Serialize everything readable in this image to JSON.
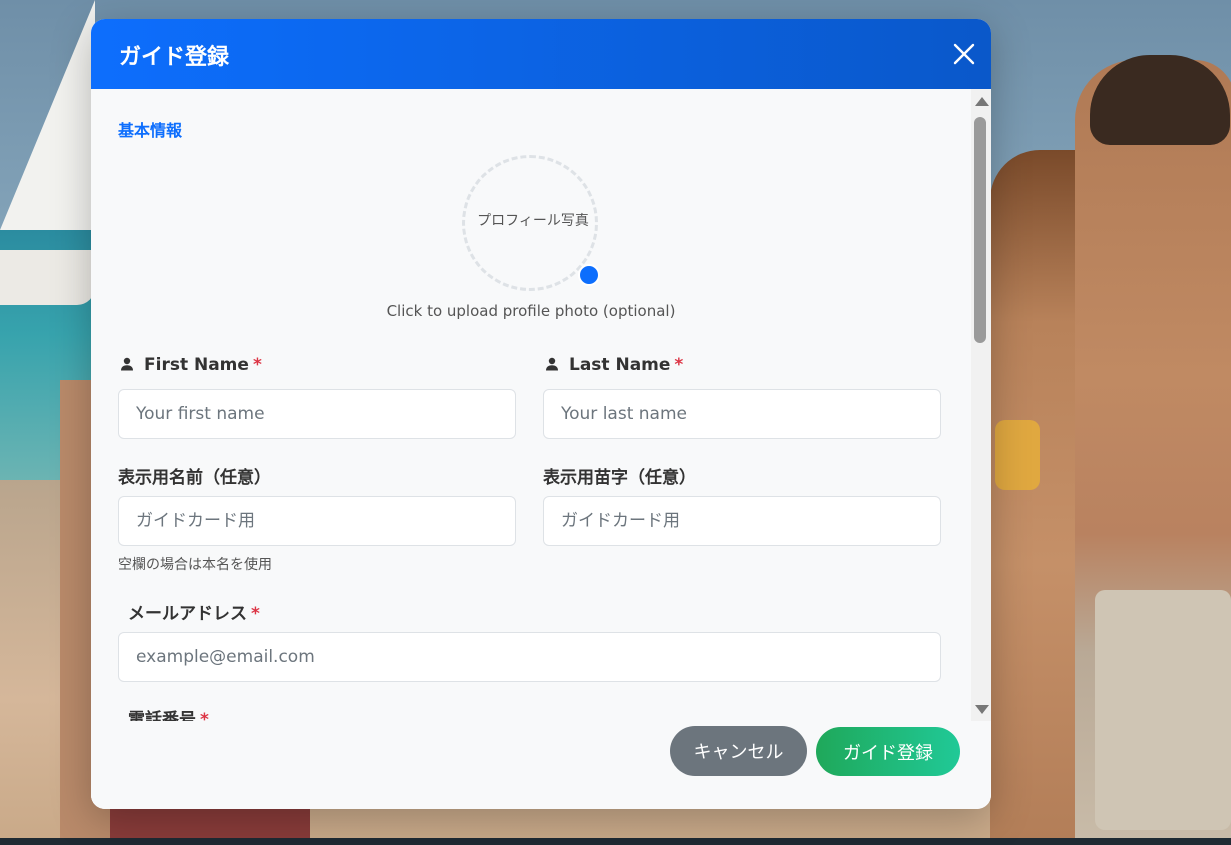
{
  "modal": {
    "title": "ガイド登録",
    "section_basic": "基本情報",
    "photo": {
      "label": "プロフィール写真",
      "hint": "Click to upload profile photo (optional)"
    },
    "first_name": {
      "label": "First Name",
      "required": "*",
      "placeholder": "Your first name"
    },
    "last_name": {
      "label": "Last Name",
      "required": "*",
      "placeholder": "Your last name"
    },
    "display_first": {
      "label": "表示用名前（任意）",
      "placeholder": "ガイドカード用",
      "help": "空欄の場合は本名を使用"
    },
    "display_last": {
      "label": "表示用苗字（任意）",
      "placeholder": "ガイドカード用"
    },
    "email": {
      "label": "メールアドレス",
      "required": "*",
      "placeholder": "example@email.com"
    },
    "phone": {
      "label": "電話番号",
      "required": "*"
    },
    "buttons": {
      "cancel": "キャンセル",
      "submit": "ガイド登録"
    }
  },
  "colors": {
    "primary": "#0d6efd",
    "success": "#1fa85a",
    "secondary": "#6c757d",
    "danger": "#dc3545"
  }
}
